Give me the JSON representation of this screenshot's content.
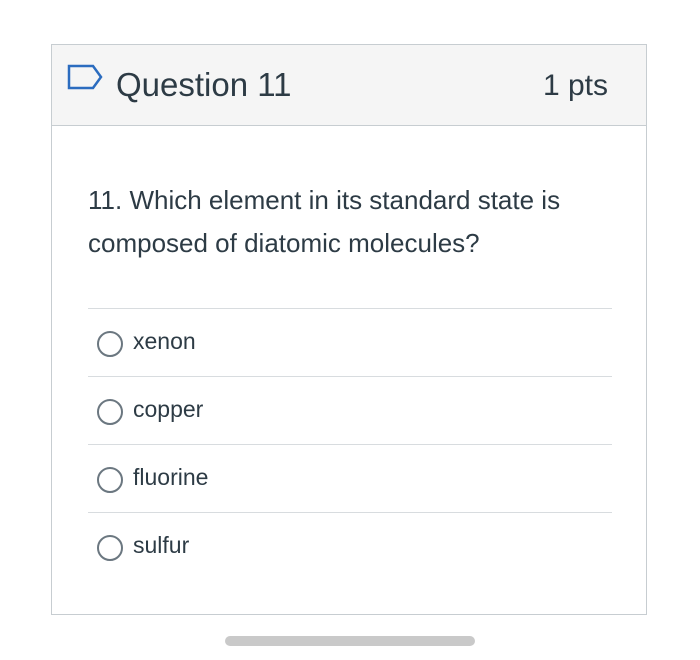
{
  "question": {
    "title": "Question 11",
    "points": "1 pts",
    "flag_icon": "flag-outline-icon",
    "text": "11. Which element in its standard state is composed of diatomic molecules?"
  },
  "answers": [
    {
      "label": "xenon",
      "selected": false
    },
    {
      "label": "copper",
      "selected": false
    },
    {
      "label": "fluorine",
      "selected": false
    },
    {
      "label": "sulfur",
      "selected": false
    }
  ],
  "colors": {
    "accent": "#2b6cbf",
    "text": "#2d3b45",
    "header_bg": "#f5f5f5",
    "border": "#c7cdd1"
  }
}
